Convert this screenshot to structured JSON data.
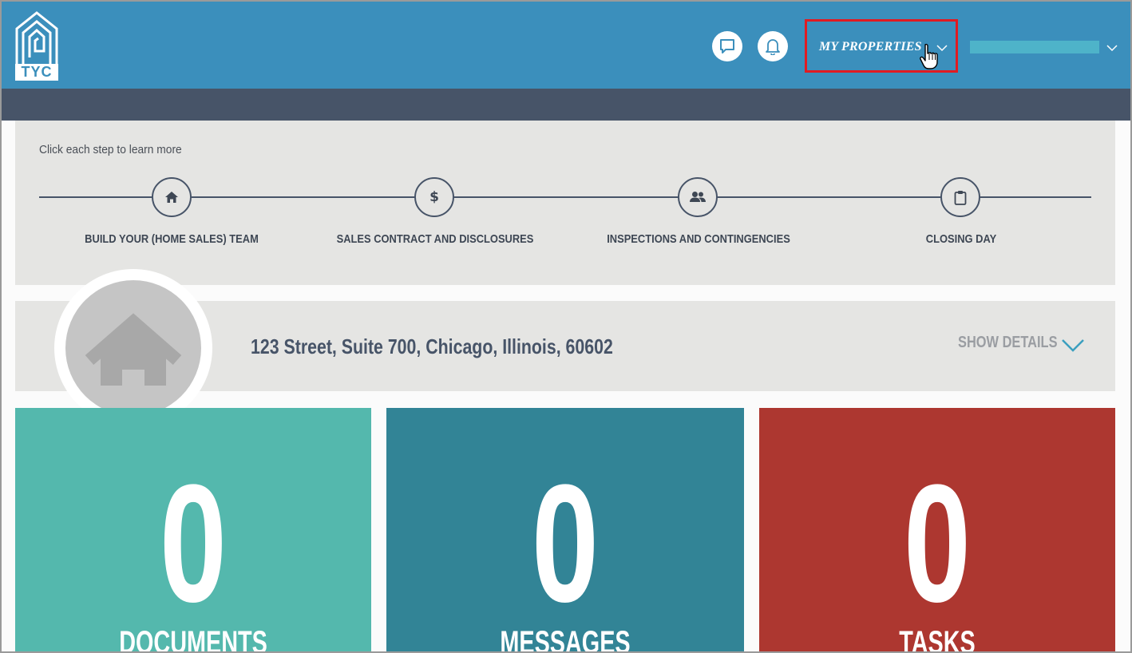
{
  "header": {
    "logo_text": "TYC",
    "chat_icon": "chat-icon",
    "bell_icon": "bell-icon",
    "my_properties_label": "MY PROPERTIES",
    "user_name_redacted": true
  },
  "steps": {
    "hint": "Click each step to learn more",
    "items": [
      {
        "label": "BUILD YOUR (HOME SALES) TEAM",
        "icon": "home-icon"
      },
      {
        "label": "SALES CONTRACT AND DISCLOSURES",
        "icon": "dollar-icon"
      },
      {
        "label": "INSPECTIONS AND CONTINGENCIES",
        "icon": "people-icon"
      },
      {
        "label": "CLOSING DAY",
        "icon": "clipboard-icon"
      }
    ]
  },
  "property": {
    "address": "123 Street, Suite 700, Chicago, Illinois, 60602",
    "show_details_label": "SHOW DETAILS"
  },
  "tiles": [
    {
      "count": "0",
      "label": "DOCUMENTS",
      "color": "#54b8ad"
    },
    {
      "count": "0",
      "label": "MESSAGES",
      "color": "#328496"
    },
    {
      "count": "0",
      "label": "TASKS",
      "color": "#ad3730"
    }
  ],
  "colors": {
    "header": "#3b8fbc",
    "subbar": "#475468",
    "panel": "#e5e5e3",
    "highlight": "#e11b22"
  }
}
